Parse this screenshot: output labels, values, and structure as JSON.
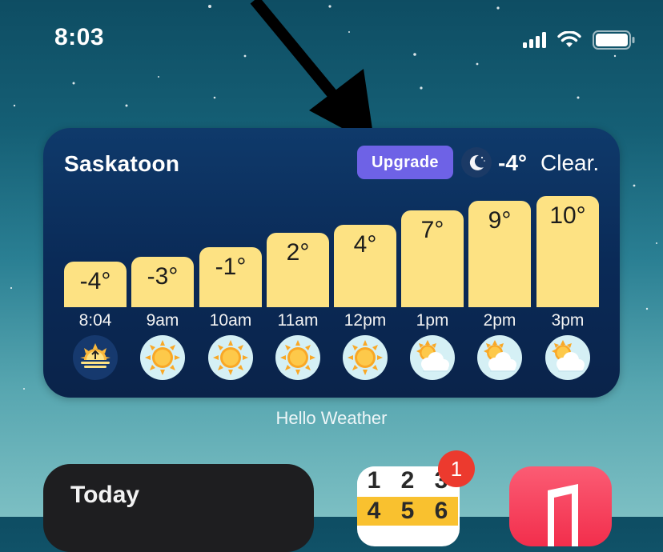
{
  "status_bar": {
    "time": "8:03"
  },
  "widget": {
    "city": "Saskatoon",
    "upgrade_label": "Upgrade",
    "current_temp": "-4°",
    "current_condition": "Clear.",
    "current_icon": "moon-icon",
    "hourly": [
      {
        "time": "8:04",
        "temp": "-4°",
        "icon": "sunrise-icon"
      },
      {
        "time": "9am",
        "temp": "-3°",
        "icon": "sun-icon"
      },
      {
        "time": "10am",
        "temp": "-1°",
        "icon": "sun-icon"
      },
      {
        "time": "11am",
        "temp": "2°",
        "icon": "sun-icon"
      },
      {
        "time": "12pm",
        "temp": "4°",
        "icon": "sun-icon"
      },
      {
        "time": "1pm",
        "temp": "7°",
        "icon": "partly-cloudy-icon"
      },
      {
        "time": "2pm",
        "temp": "9°",
        "icon": "partly-cloudy-icon"
      },
      {
        "time": "3pm",
        "temp": "10°",
        "icon": "partly-cloudy-icon"
      }
    ],
    "label": "Hello Weather"
  },
  "bottom_row": {
    "today_label": "Today",
    "numbers_grid": [
      "1",
      "2",
      "3",
      "4",
      "5",
      "6"
    ],
    "badge_count": "1"
  },
  "colors": {
    "bar": "#fde283",
    "upgrade": "#6e62e6",
    "widget_bg": "#0a2a57",
    "badge": "#ec3a2e"
  }
}
